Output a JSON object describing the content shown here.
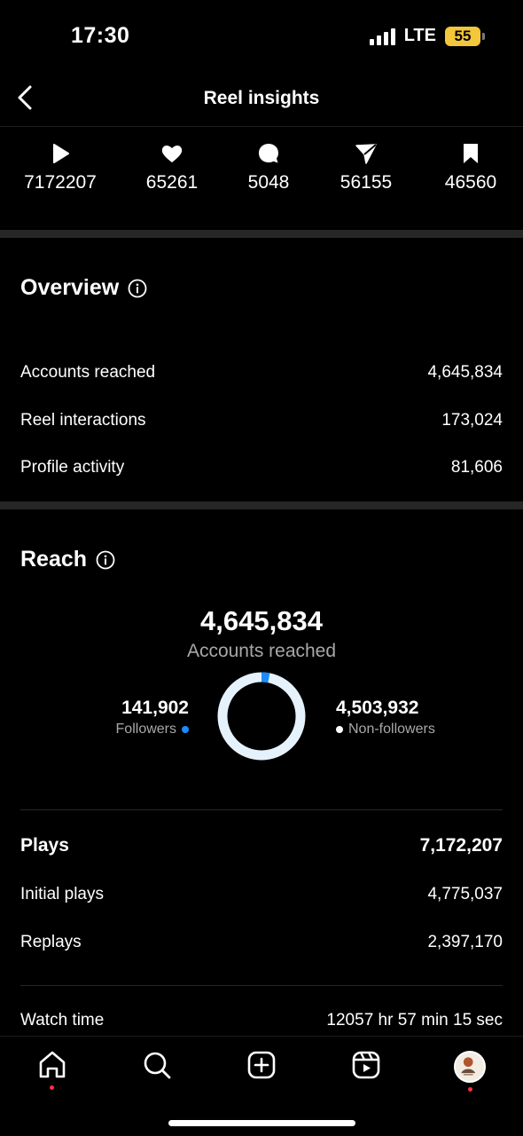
{
  "status_bar": {
    "time": "17:30",
    "network": "LTE",
    "battery": "55"
  },
  "header": {
    "title": "Reel insights"
  },
  "stats": {
    "plays": "7172207",
    "likes": "65261",
    "comments": "5048",
    "shares": "56155",
    "saves": "46560"
  },
  "overview": {
    "title": "Overview",
    "rows": [
      {
        "label": "Accounts reached",
        "value": "4,645,834"
      },
      {
        "label": "Reel interactions",
        "value": "173,024"
      },
      {
        "label": "Profile activity",
        "value": "81,606"
      }
    ]
  },
  "reach": {
    "title": "Reach",
    "total": "4,645,834",
    "total_label": "Accounts reached",
    "followers": {
      "value": "141,902",
      "label": "Followers"
    },
    "non_followers": {
      "value": "4,503,932",
      "label": "Non-followers"
    },
    "followers_share": 0.0305,
    "colors": {
      "followers": "#1a8cff",
      "non_followers": "#e6f2fb"
    }
  },
  "plays": {
    "title": "Plays",
    "total": "7,172,207",
    "rows": [
      {
        "label": "Initial plays",
        "value": "4,775,037"
      },
      {
        "label": "Replays",
        "value": "2,397,170"
      }
    ]
  },
  "watch_time": {
    "label": "Watch time",
    "value": "12057 hr 57 min 15 sec"
  },
  "nav": [
    "home-icon",
    "search-icon",
    "create-icon",
    "reels-icon",
    "profile-avatar"
  ]
}
